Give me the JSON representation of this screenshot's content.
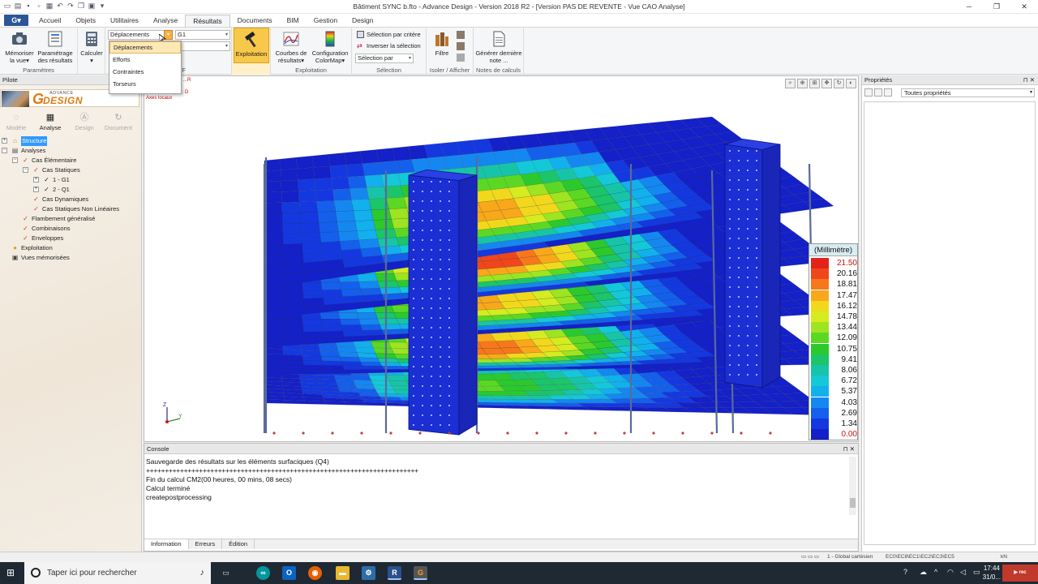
{
  "window": {
    "title": "Bâtiment SYNC b.fto - Advance Design - Version 2018 R2 - [Version PAS DE REVENTE - Vue CAO Analyse]"
  },
  "ribbon": {
    "app_button": "G",
    "tabs": [
      "Accueil",
      "Objets",
      "Utilitaires",
      "Analyse",
      "Résultats",
      "Documents",
      "BIM",
      "Gestion",
      "Design"
    ],
    "active_tab": "Résultats",
    "groups": {
      "parametres": {
        "label": "Paramètres",
        "memoriser": "Mémoriser la vue",
        "parametrage": "Paramétrage des résultats"
      },
      "calculer": "Calculer",
      "resultats_ef": {
        "label": "Résultats EF",
        "type_combo": "Déplacements",
        "case_combo": "G1"
      },
      "exploitation_btn": "Exploitation",
      "exploitation": {
        "label": "Exploitation",
        "courbes": "Courbes de résultats",
        "config": "Configuration ColorMap"
      },
      "selection": {
        "label": "Sélection",
        "par_critere": "Sélection par critère",
        "inverser": "Inverser la sélection",
        "par_combo": "Sélection par"
      },
      "isoler": {
        "label": "Isoler / Afficher",
        "filtre": "Filtre"
      },
      "notes": {
        "label": "Notes de calculs",
        "generer": "Générer dernière note ..."
      }
    },
    "dropdown_options": [
      "Déplacements",
      "Efforts",
      "Contraintes",
      "Torseurs"
    ],
    "dropdown_selected": "Déplacements"
  },
  "pilote": {
    "title": "Pilote",
    "logo_advance": "ADVANCE",
    "logo_design": "DESIGN",
    "modes": [
      "Modèle",
      "Analyse",
      "Design",
      "Document"
    ],
    "active_mode": "Analyse",
    "tree": [
      {
        "label": "Structure",
        "level": 0,
        "selected": true,
        "expander": "+"
      },
      {
        "label": "Analyses",
        "level": 0,
        "expander": "−"
      },
      {
        "label": "Cas Élémentaire",
        "level": 1,
        "expander": "−"
      },
      {
        "label": "Cas Statiques",
        "level": 2,
        "expander": "−"
      },
      {
        "label": "1 - G1",
        "level": 3,
        "expander": "+"
      },
      {
        "label": "2 - Q1",
        "level": 3,
        "expander": "+"
      },
      {
        "label": "Cas Dynamiques",
        "level": 2
      },
      {
        "label": "Cas Statiques Non Linéaires",
        "level": 2
      },
      {
        "label": "Flambement généralisé",
        "level": 1
      },
      {
        "label": "Combinaisons",
        "level": 1
      },
      {
        "label": "Enveloppes",
        "level": 1
      },
      {
        "label": "Exploitation",
        "level": 0
      },
      {
        "label": "Vues mémorisées",
        "level": 0
      }
    ]
  },
  "viewport": {
    "overlay_text": [
      "...R",
      "...que : D",
      "Axes locaux"
    ],
    "axis_labels": {
      "z": "Z",
      "y": "Y",
      "x": "X"
    }
  },
  "legend": {
    "unit": "(Millimètre)",
    "entries": [
      {
        "value": "21.50",
        "color": "#e4221c",
        "text_color": "#d01010"
      },
      {
        "value": "20.16",
        "color": "#f0461c",
        "text_color": "#111111"
      },
      {
        "value": "18.81",
        "color": "#f6781a",
        "text_color": "#111111"
      },
      {
        "value": "17.47",
        "color": "#f8a81a",
        "text_color": "#111111"
      },
      {
        "value": "16.12",
        "color": "#f2d81c",
        "text_color": "#111111"
      },
      {
        "value": "14.78",
        "color": "#d4ec20",
        "text_color": "#111111"
      },
      {
        "value": "13.44",
        "color": "#9ee420",
        "text_color": "#111111"
      },
      {
        "value": "12.09",
        "color": "#5cd824",
        "text_color": "#111111"
      },
      {
        "value": "10.75",
        "color": "#2bc92e",
        "text_color": "#111111"
      },
      {
        "value": "9.41",
        "color": "#1cc46a",
        "text_color": "#111111"
      },
      {
        "value": "8.06",
        "color": "#18c4a8",
        "text_color": "#111111"
      },
      {
        "value": "6.72",
        "color": "#14c8d8",
        "text_color": "#111111"
      },
      {
        "value": "5.37",
        "color": "#12b0ec",
        "text_color": "#111111"
      },
      {
        "value": "4.03",
        "color": "#1488f0",
        "text_color": "#111111"
      },
      {
        "value": "2.69",
        "color": "#1460ec",
        "text_color": "#111111"
      },
      {
        "value": "1.34",
        "color": "#1438e0",
        "text_color": "#111111"
      },
      {
        "value": "0.00",
        "color": "#1420c8",
        "text_color": "#d01010"
      }
    ]
  },
  "console": {
    "title": "Console",
    "lines": [
      "Sauvegarde des résultats sur les éléments surfaciques (Q4)",
      "++++++++++++++++++++++++++++++++++++++++++++++++++++++++++++++++++++++++",
      "Fin du calcul CM2(00 heures, 00 mins, 08 secs)",
      "Calcul terminé",
      "createpostprocessing"
    ],
    "tabs": [
      "Information",
      "Erreurs",
      "Édition"
    ]
  },
  "properties": {
    "title": "Propriétés",
    "filter": "Toutes propriétés"
  },
  "statusbar": {
    "coord_system": "1 - Global cartésien",
    "codes": "EC0\\EC8\\EC1\\EC2\\EC3\\EC5",
    "unit": "kN"
  },
  "taskbar": {
    "search_placeholder": "Taper ici pour rechercher",
    "time": "17:44",
    "date": "31/0..."
  }
}
